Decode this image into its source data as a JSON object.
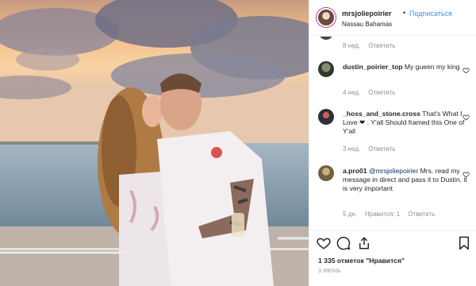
{
  "header": {
    "username": "mrsjoliepoirier",
    "separator": "•",
    "follow_label": "Подписаться",
    "location": "Nassau Bahamas"
  },
  "comments": [
    {
      "meta_time": "8 нед.",
      "meta_reply": "Ответить"
    },
    {
      "user": "dustin_poirier_top",
      "text": "My gueen my king",
      "meta_time": "4 нед.",
      "meta_reply": "Ответить"
    },
    {
      "user": "_hoss_and_stone.cross",
      "text_1": "That's What I Love",
      "heart": "❤",
      "text_2": ". Y'all Should framed this One of Y'all",
      "meta_time": "3 нед.",
      "meta_reply": "Ответить"
    },
    {
      "user": "a.pro01",
      "mention": "@mrsjoliepoirier",
      "text": "Mrs. read my message in direct and pass it to Dustin, it is very important",
      "meta_time": "5 дн.",
      "meta_likes": "Нравится: 1",
      "meta_reply": "Ответить"
    }
  ],
  "actions": {
    "like_icon": "heart-outline-icon",
    "comment_icon": "comment-icon",
    "share_icon": "share-icon",
    "save_icon": "bookmark-icon"
  },
  "likes_text": "1 335 отметок \"Нравится\"",
  "date_text": "3 ИЮНЬ",
  "colors": {
    "link": "#3897f0",
    "text": "#262626",
    "muted": "#8e8e8e",
    "border": "#efefef"
  }
}
